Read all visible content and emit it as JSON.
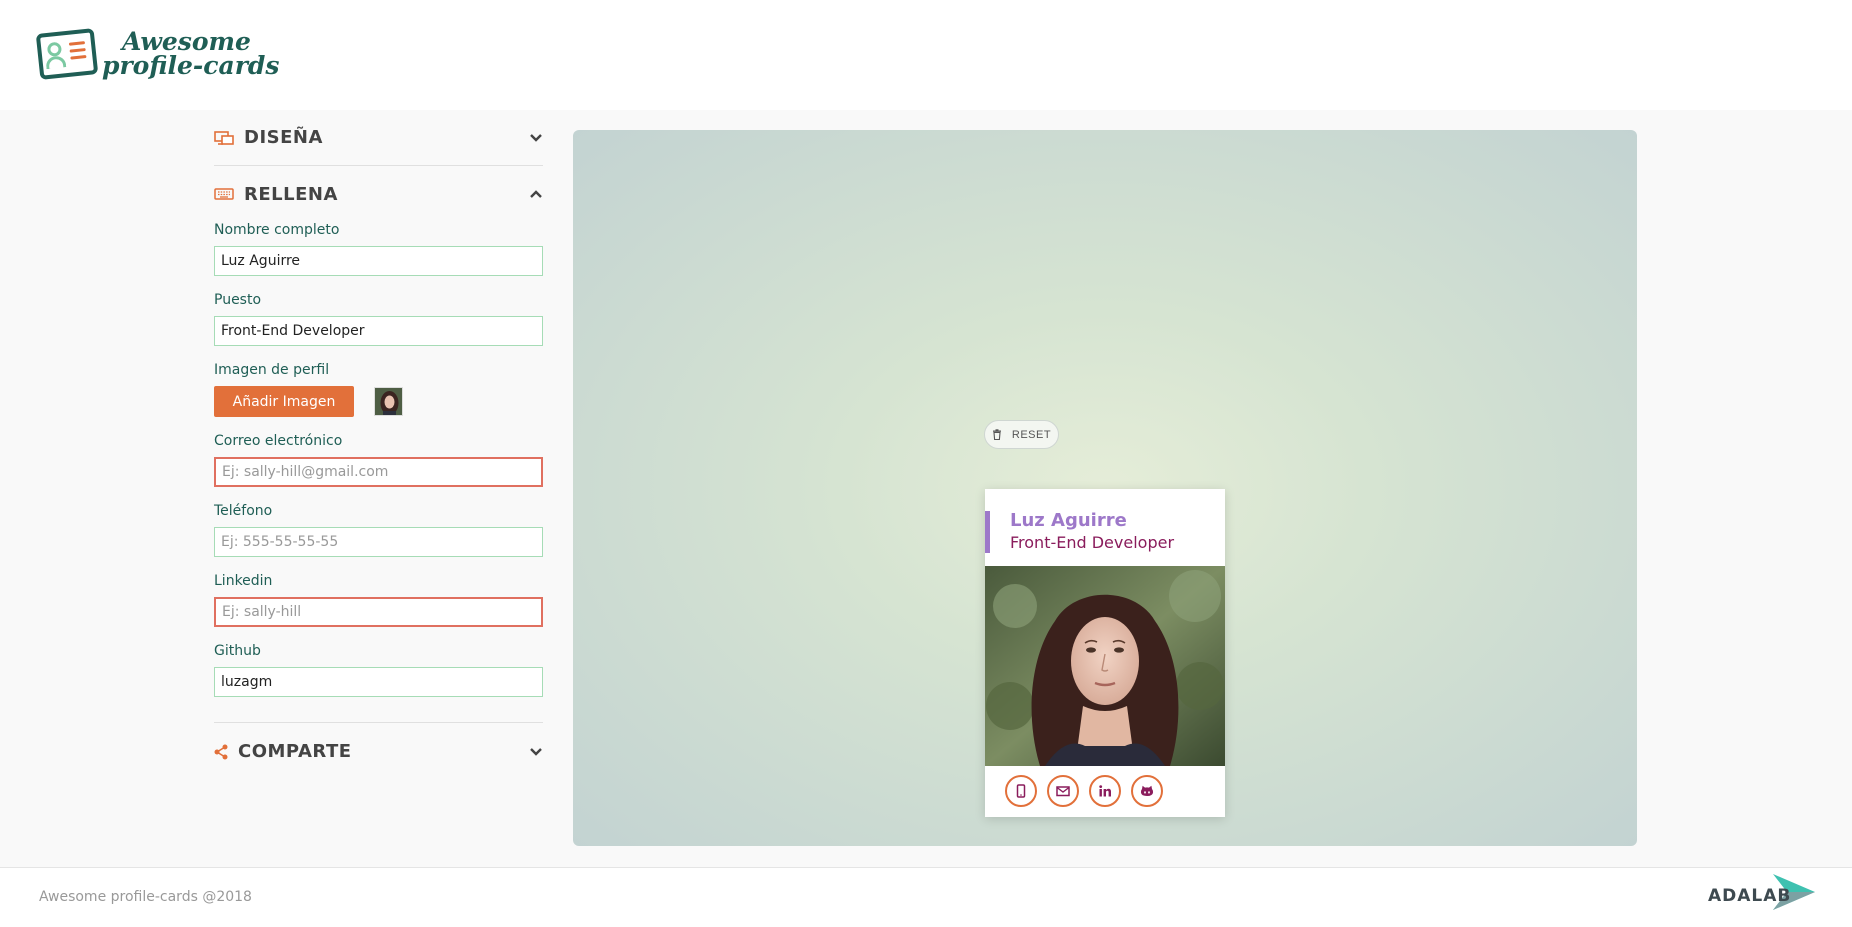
{
  "header": {
    "logo_line1": "Awesome",
    "logo_line2": "profile-cards"
  },
  "sections": {
    "design": {
      "title": "DISEÑA",
      "icon": "monitor-icon",
      "expanded": false
    },
    "fill": {
      "title": "RELLENA",
      "icon": "keyboard-icon",
      "expanded": true
    },
    "share": {
      "title": "COMPARTE",
      "icon": "share-icon",
      "expanded": false
    }
  },
  "form": {
    "name": {
      "label": "Nombre completo",
      "value": "Luz Aguirre",
      "placeholder": ""
    },
    "job": {
      "label": "Puesto",
      "value": "Front-End Developer",
      "placeholder": ""
    },
    "image": {
      "label": "Imagen de perfil",
      "button": "Añadir Imagen"
    },
    "email": {
      "label": "Correo electrónico",
      "value": "",
      "placeholder": "Ej: sally-hill@gmail.com"
    },
    "phone": {
      "label": "Teléfono",
      "value": "",
      "placeholder": "Ej: 555-55-55-55"
    },
    "linkedin": {
      "label": "Linkedin",
      "value": "",
      "placeholder": "Ej: sally-hill"
    },
    "github": {
      "label": "Github",
      "value": "luzagm",
      "placeholder": ""
    }
  },
  "preview": {
    "reset_label": "RESET",
    "card": {
      "name": "Luz Aguirre",
      "job": "Front-End Developer",
      "icons": [
        "phone-icon",
        "mail-icon",
        "linkedin-icon",
        "github-icon"
      ]
    }
  },
  "footer": {
    "copyright": "Awesome profile-cards @2018",
    "brand": "ADALAB"
  },
  "colors": {
    "accent": "#e2703a",
    "dark_green": "#1f5e55",
    "card_name": "#9d78c9",
    "card_job": "#8a1c5c",
    "error_border": "#e07060",
    "input_border": "#a6dcb6"
  }
}
